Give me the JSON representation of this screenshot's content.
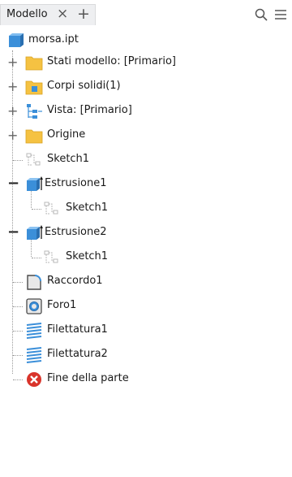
{
  "tab": {
    "title": "Modello",
    "close": "×",
    "add": "+"
  },
  "toolbar": {
    "search_icon": "search-icon",
    "menu_icon": "hamburger-menu-icon"
  },
  "tree": {
    "root": "morsa.ipt",
    "stati": "Stati modello: [Primario]",
    "corpi": "Corpi solidi(1)",
    "vista": "Vista: [Primario]",
    "origine": "Origine",
    "sketch_top": "Sketch1",
    "estrusione1": "Estrusione1",
    "estrusione1_sketch": "Sketch1",
    "estrusione2": "Estrusione2",
    "estrusione2_sketch": "Sketch1",
    "raccordo": "Raccordo1",
    "foro": "Foro1",
    "filettatura1": "Filettatura1",
    "filettatura2": "Filettatura2",
    "fine": "Fine della parte"
  },
  "colors": {
    "folder": "#f5c242",
    "part_blue": "#3b8fd9",
    "end_red": "#d9342b"
  }
}
